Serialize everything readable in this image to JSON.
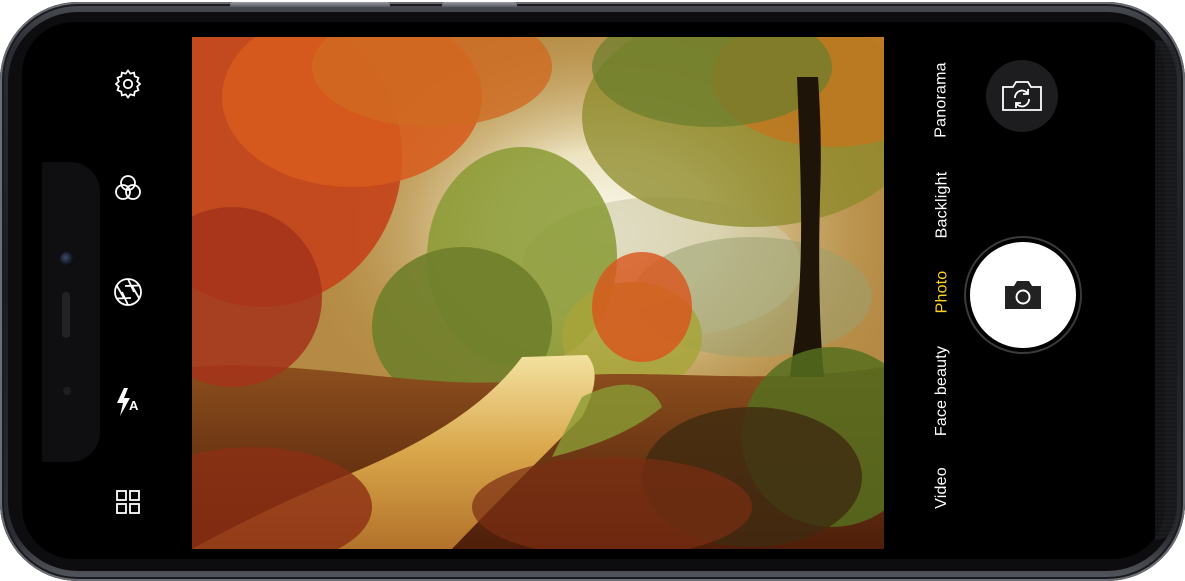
{
  "camera": {
    "left_controls": [
      {
        "icon": "settings-gear-icon"
      },
      {
        "icon": "filters-circles-icon"
      },
      {
        "icon": "aperture-icon"
      },
      {
        "icon": "flash-auto-icon",
        "label": "A"
      },
      {
        "icon": "grid-icon"
      }
    ],
    "modes": [
      {
        "label": "Panorama",
        "active": false
      },
      {
        "label": "Backlight",
        "active": false
      },
      {
        "label": "Photo",
        "active": true
      },
      {
        "label": "Face beauty",
        "active": false
      },
      {
        "label": "Video",
        "active": false
      }
    ],
    "active_color": "#ffd21f",
    "switch_camera_icon": "switch-camera-icon",
    "shutter_icon": "camera-icon"
  }
}
